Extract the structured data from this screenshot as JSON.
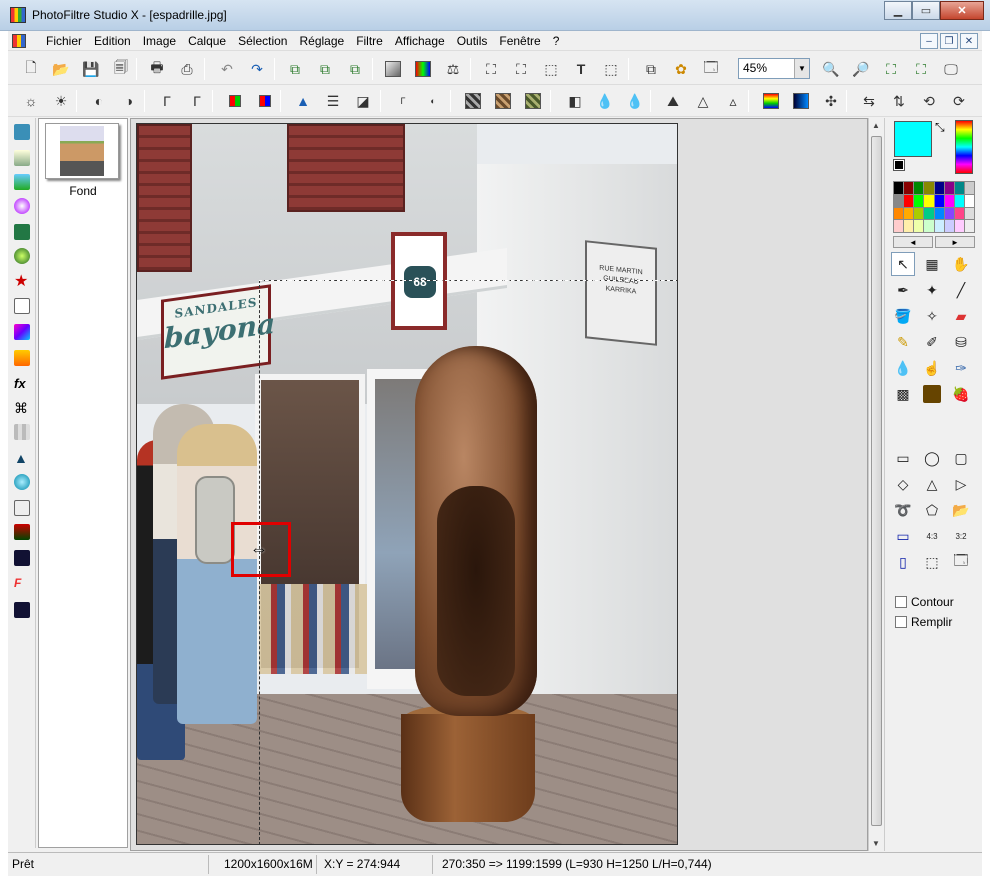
{
  "window": {
    "title": "PhotoFiltre Studio X - [espadrille.jpg]"
  },
  "menubar": {
    "items": [
      "Fichier",
      "Edition",
      "Image",
      "Calque",
      "Sélection",
      "Réglage",
      "Filtre",
      "Affichage",
      "Outils",
      "Fenêtre",
      "?"
    ]
  },
  "toolbar": {
    "zoom_value": "45%"
  },
  "layers": {
    "items": [
      {
        "label": "Fond"
      }
    ]
  },
  "photo": {
    "sign_small": "SANDALES",
    "sign_big": "bayona",
    "number": "68",
    "street_sign": "RUE MARTIN GUILBEAU KARRIKA"
  },
  "right_panel": {
    "foreground_color": "#00ffff",
    "background_color": "#000000",
    "contour_label": "Contour",
    "remplir_label": "Remplir"
  },
  "status": {
    "state": "Prêt",
    "image_size": "1200x1600x16M",
    "coords": "X:Y = 274:944",
    "selection": "270:350 => 1199:1599 (L=930  H=1250  L/H=0,744)"
  }
}
